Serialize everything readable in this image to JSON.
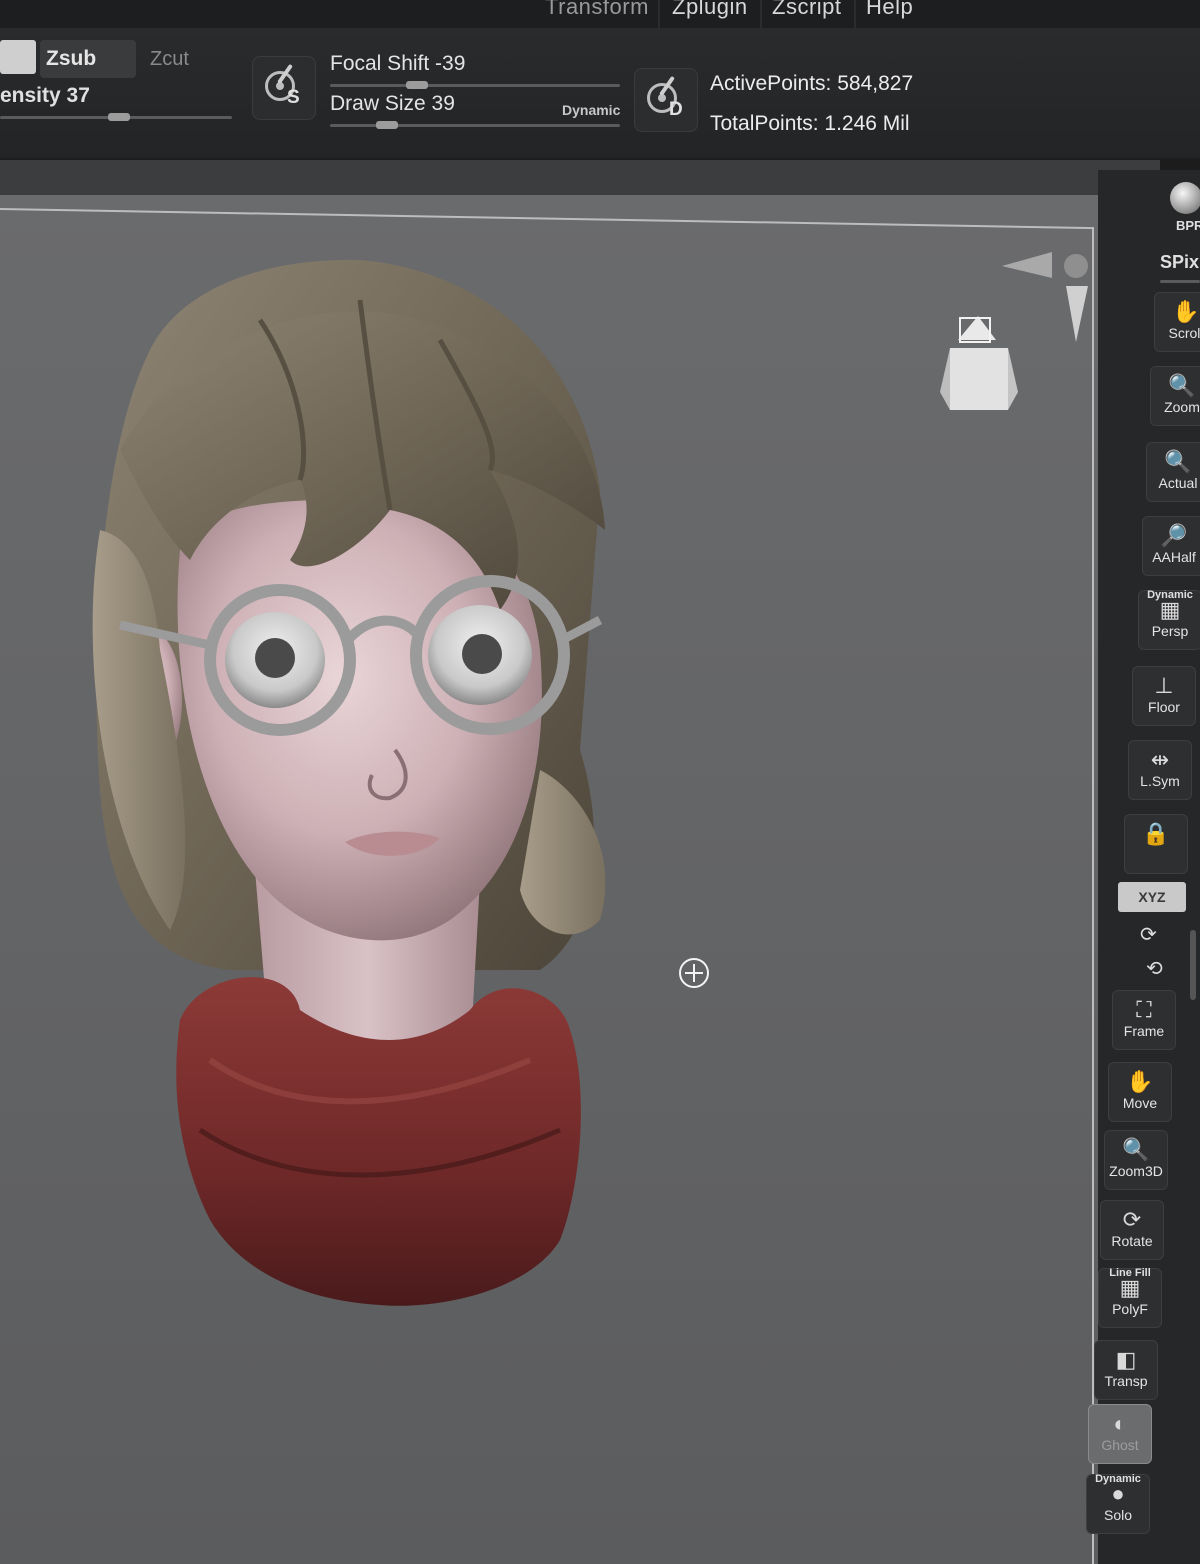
{
  "menu": {
    "items": [
      {
        "label": "Transform"
      },
      {
        "label": "Zplugin"
      },
      {
        "label": "Zscript"
      },
      {
        "label": "Help"
      }
    ]
  },
  "toolbar": {
    "zsub_label": "Zsub",
    "zcut_label": "Zcut",
    "intensity_label": "ensity 37",
    "focal_shift_label": "Focal Shift -39",
    "draw_size_label": "Draw Size 39",
    "dynamic_label": "Dynamic",
    "brush_s_letter": "S",
    "brush_d_letter": "D",
    "active_points_label": "ActivePoints: 584,827",
    "total_points_label": "TotalPoints: 1.246 Mil"
  },
  "shelf": {
    "bpr_label": "BPR",
    "spix_label": "SPix",
    "buttons": [
      {
        "label": "Scroll",
        "icon": "hand-icon"
      },
      {
        "label": "Zoom",
        "icon": "magnifier-icon"
      },
      {
        "label": "Actual",
        "icon": "magnifier-x1-icon"
      },
      {
        "label": "AAHalf",
        "icon": "magnifier-half-icon"
      },
      {
        "label": "Persp",
        "sub": "Dynamic",
        "icon": "grid-perspective-icon"
      },
      {
        "label": "Floor",
        "icon": "floor-icon"
      },
      {
        "label": "L.Sym",
        "icon": "symmetry-arrows-icon"
      },
      {
        "label": "",
        "icon": "local-lock-icon"
      },
      {
        "label": "XYZ",
        "icon": "xyz-rotate-icon"
      },
      {
        "label": "Frame",
        "icon": "frame-icon"
      },
      {
        "label": "Move",
        "icon": "move-hand-icon"
      },
      {
        "label": "Zoom3D",
        "icon": "zoom3d-icon"
      },
      {
        "label": "Rotate",
        "icon": "rotate-icon"
      },
      {
        "label": "PolyF",
        "sub": "Line Fill",
        "icon": "polyframe-grid-icon"
      },
      {
        "label": "Transp",
        "icon": "transparency-icon"
      },
      {
        "label": "Ghost",
        "icon": "ghost-icon"
      },
      {
        "label": "Solo",
        "sub": "Dynamic",
        "icon": "solo-icon"
      }
    ]
  },
  "canvas": {
    "cursor_icon": "crosshair-icon",
    "model": "stylized-girl-bust"
  }
}
